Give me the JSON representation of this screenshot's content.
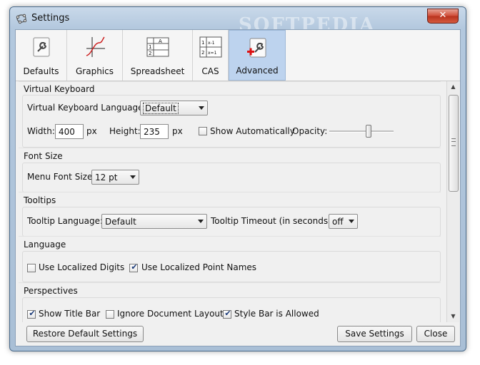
{
  "window": {
    "title": "Settings",
    "close_label": "✕",
    "watermark": "SOFTPEDIA"
  },
  "tabs": [
    {
      "label": "Defaults",
      "icon": "wrench-icon",
      "active": false
    },
    {
      "label": "Graphics",
      "icon": "graph-icon",
      "active": false
    },
    {
      "label": "Spreadsheet",
      "icon": "spreadsheet-icon",
      "active": false
    },
    {
      "label": "CAS",
      "icon": "cas-icon",
      "active": false
    },
    {
      "label": "Advanced",
      "icon": "advanced-wrench-icon",
      "active": true
    }
  ],
  "virtual_keyboard": {
    "title": "Virtual Keyboard",
    "language_label": "Virtual Keyboard Language:",
    "language_value": "Default",
    "width_label": "Width:",
    "width_value": "400",
    "width_unit": "px",
    "height_label": "Height:",
    "height_value": "235",
    "height_unit": "px",
    "show_auto_label": "Show Automatically",
    "show_auto_checked": false,
    "opacity_label": "Opacity:",
    "opacity_level": 0.7
  },
  "font_size": {
    "title": "Font Size",
    "menu_label": "Menu Font Size:",
    "menu_value": "12 pt"
  },
  "tooltips": {
    "title": "Tooltips",
    "language_label": "Tooltip Language:",
    "language_value": "Default",
    "timeout_label": "Tooltip Timeout (in seconds):",
    "timeout_value": "off"
  },
  "language": {
    "title": "Language",
    "localized_digits_label": "Use Localized Digits",
    "localized_digits_checked": false,
    "localized_points_label": "Use Localized Point Names",
    "localized_points_checked": true
  },
  "perspectives": {
    "title": "Perspectives",
    "show_title_bar_label": "Show Title Bar",
    "show_title_bar_checked": true,
    "ignore_layout_label": "Ignore Document Layout",
    "ignore_layout_checked": false,
    "style_bar_label": "Style Bar is Allowed",
    "style_bar_checked": true
  },
  "footer": {
    "restore_label": "Restore Default Settings",
    "save_label": "Save Settings",
    "close_label": "Close"
  },
  "check_mark": "✔",
  "colors": {
    "active_tab": "#bdd3ee",
    "title_bar": "#b3c8de",
    "close_button": "#cf4b36"
  }
}
